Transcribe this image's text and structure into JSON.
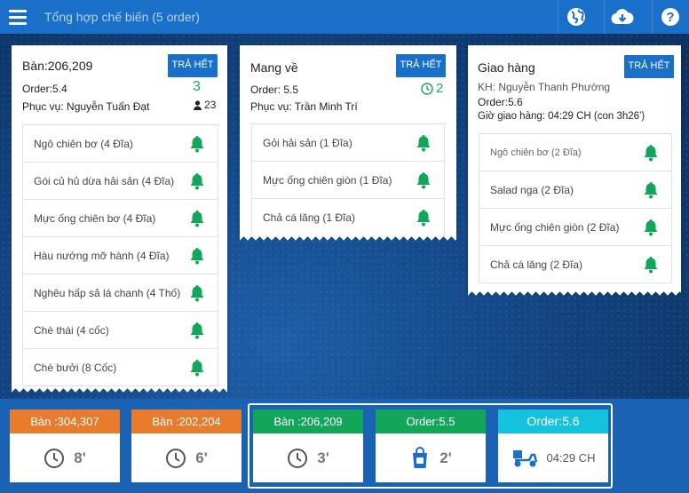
{
  "topbar": {
    "search_text": "Tổng hợp chế biến (5 order)"
  },
  "colors": {
    "primary": "#1a6fc9",
    "green": "#27a36b",
    "orange": "#e97c2c",
    "teal": "#12a65a",
    "cyan": "#14c2de"
  },
  "cards": [
    {
      "title": "Bàn:206,209",
      "button": "TRẢ HẾT",
      "order": "Order:5.4",
      "count": "3",
      "server": "Phục vụ: Nguyễn Tuấn Đạt",
      "guests": "23",
      "items": [
        "Ngô chiên bơ (4 Đĩa)",
        "Gói củ hủ dừa hải sản (4 Đĩa)",
        "Mực ống chiên bơ (4 Đĩa)",
        "Hàu nướng mỡ hành (4 Đĩa)",
        "Nghêu hấp sả lá chanh (4 Thố)",
        "Chè thái (4 cốc)",
        "Chè bưởi (8 Cốc)"
      ]
    },
    {
      "title": "Mang về",
      "button": "TRẢ HẾT",
      "order": "Order: 5.5",
      "count": "2",
      "server": "Phục vụ: Trần Minh Trí",
      "items": [
        "Gỏi hải sản (1 Đĩa)",
        "Mực ống chiên giòn (1 Đĩa)",
        "Chả cá lăng (1 Đĩa)"
      ]
    },
    {
      "title": "Giao hàng",
      "button": "TRẢ HẾT",
      "customer": "KH: Nguyễn Thanh Phường",
      "order": "Order:5.6",
      "delivery": "Giờ giao hàng: 04:29 CH (con 3h26')",
      "items": [
        "Ngô chiên bơ (2 Đĩa)",
        "Salad nga (2 Đĩa)",
        "Mực ống chiên giòn (2 Đĩa)",
        "Chả cá lăng (2 Đĩa)"
      ]
    }
  ],
  "mini_cards": [
    {
      "title": "Bàn :304,307",
      "value": "8'",
      "icon": "clock-icon"
    },
    {
      "title": "Bàn :202,204",
      "value": "6'",
      "icon": "clock-icon"
    },
    {
      "title": "Bàn :206,209",
      "value": "3'",
      "icon": "clock-icon"
    },
    {
      "title": "Order:5.5",
      "value": "2'",
      "icon": "takeaway-bag-icon"
    },
    {
      "title": "Order:5.6",
      "value": "04:29 CH",
      "icon": "delivery-scooter-icon"
    }
  ]
}
